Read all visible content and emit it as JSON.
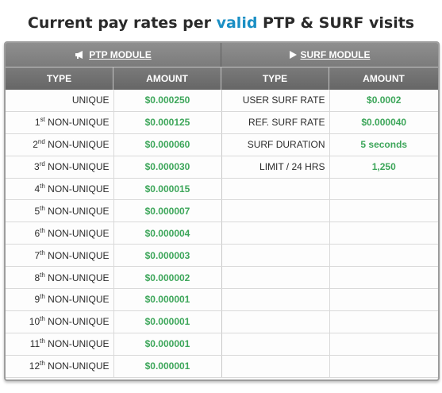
{
  "title": {
    "before": "Current pay rates per ",
    "accent": "valid",
    "after": " PTP & SURF visits"
  },
  "ptp": {
    "header": "PTP MODULE",
    "header_icon": "megaphone-icon",
    "col_type": "TYPE",
    "col_amount": "AMOUNT",
    "rows": [
      {
        "sup": "",
        "label": "UNIQUE",
        "amount": "$0.000250"
      },
      {
        "sup": "st",
        "num": "1",
        "label": " NON-UNIQUE",
        "amount": "$0.000125"
      },
      {
        "sup": "nd",
        "num": "2",
        "label": " NON-UNIQUE",
        "amount": "$0.000060"
      },
      {
        "sup": "rd",
        "num": "3",
        "label": " NON-UNIQUE",
        "amount": "$0.000030"
      },
      {
        "sup": "th",
        "num": "4",
        "label": " NON-UNIQUE",
        "amount": "$0.000015"
      },
      {
        "sup": "th",
        "num": "5",
        "label": " NON-UNIQUE",
        "amount": "$0.000007"
      },
      {
        "sup": "th",
        "num": "6",
        "label": " NON-UNIQUE",
        "amount": "$0.000004"
      },
      {
        "sup": "th",
        "num": "7",
        "label": " NON-UNIQUE",
        "amount": "$0.000003"
      },
      {
        "sup": "th",
        "num": "8",
        "label": " NON-UNIQUE",
        "amount": "$0.000002"
      },
      {
        "sup": "th",
        "num": "9",
        "label": " NON-UNIQUE",
        "amount": "$0.000001"
      },
      {
        "sup": "th",
        "num": "10",
        "label": " NON-UNIQUE",
        "amount": "$0.000001"
      },
      {
        "sup": "th",
        "num": "11",
        "label": " NON-UNIQUE",
        "amount": "$0.000001"
      },
      {
        "sup": "th",
        "num": "12",
        "label": " NON-UNIQUE",
        "amount": "$0.000001"
      }
    ]
  },
  "surf": {
    "header": "SURF MODULE",
    "header_icon": "play-icon",
    "col_type": "TYPE",
    "col_amount": "AMOUNT",
    "rows": [
      {
        "label": "USER SURF RATE",
        "amount": "$0.0002"
      },
      {
        "label": "REF. SURF RATE",
        "amount": "$0.000040"
      },
      {
        "label": "SURF DURATION",
        "amount": "5 seconds"
      },
      {
        "label": "LIMIT / 24 HRS",
        "amount": "1,250"
      }
    ]
  },
  "colors": {
    "accent": "#1a8fc4",
    "amount_green": "#3da65a",
    "header_gray": "#7b7b7b"
  }
}
